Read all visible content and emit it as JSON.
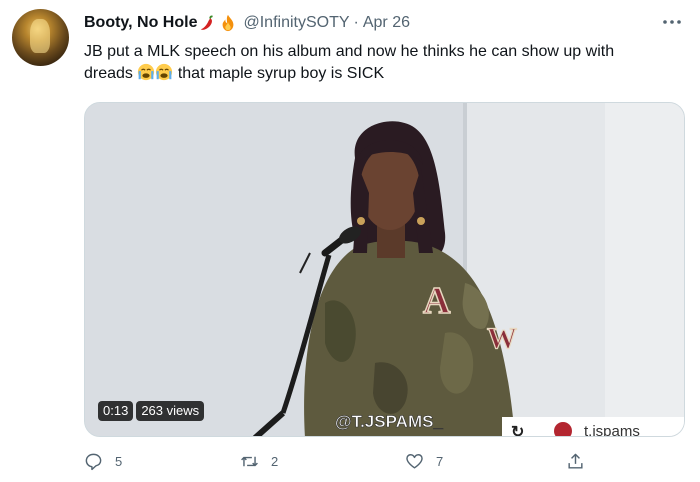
{
  "tweet": {
    "display_name": "Booty, No Hole",
    "handle": "@InfinitySOTY",
    "separator": "·",
    "date": "Apr 26",
    "text_line1": "JB put a MLK speech on his album and now he thinks he can show up with",
    "text_line2_a": "dreads",
    "text_line2_b": " that maple syrup boy is SICK",
    "emojis": [
      "chili-pepper",
      "fire",
      "loudly-crying-face",
      "loudly-crying-face"
    ]
  },
  "video": {
    "duration": "0:13",
    "views": "263 views",
    "watermark": "@T.JSPAMS_",
    "corner_handle": "t.jspams",
    "sweater_letters": [
      "A",
      "W"
    ]
  },
  "actions": {
    "reply_count": "5",
    "retweet_count": "2",
    "like_count": "7"
  },
  "colors": {
    "text": "#0f1419",
    "secondary": "#536471",
    "border": "#cfd9de"
  }
}
